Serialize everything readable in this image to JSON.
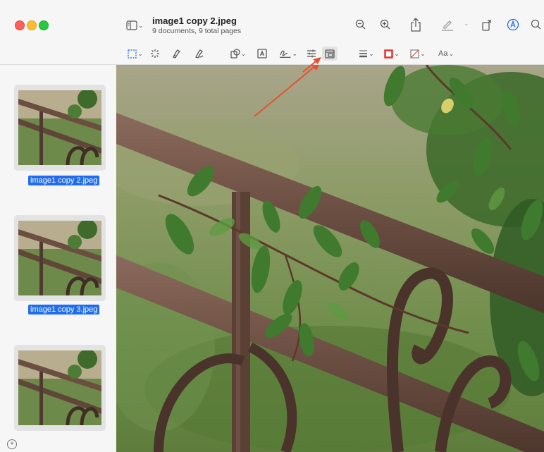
{
  "window": {
    "title": "image1 copy 2.jpeg",
    "subtitle": "9 documents, 9 total pages"
  },
  "toolbar_top": {
    "icons": [
      "sidebar-icon",
      "zoom-out-icon",
      "zoom-in-icon",
      "share-icon",
      "highlight-pen-icon",
      "rotate-icon",
      "markup-icon",
      "search-icon"
    ]
  },
  "markup_toolbar": {
    "icons": [
      "selection-tool-icon",
      "instant-alpha-icon",
      "sketch-icon",
      "draw-icon",
      "shapes-icon",
      "text-box-icon",
      "sign-icon",
      "adjust-color-icon",
      "adjust-size-icon",
      "shape-style-icon",
      "border-color-icon",
      "fill-color-icon",
      "text-style-icon"
    ],
    "text_style_label": "Aa",
    "border_color": "#e53935"
  },
  "sidebar": {
    "items": [
      {
        "label": "image1 copy 2.jpeg",
        "selected": true
      },
      {
        "label": "image1 copy 3.jpeg",
        "selected": true
      },
      {
        "label": "",
        "selected": false
      }
    ]
  },
  "annotation": {
    "arrow_color": "#e8502f"
  },
  "colors": {
    "selection_blue": "#1f6bf2",
    "accent_blue": "#1f6bf2"
  }
}
